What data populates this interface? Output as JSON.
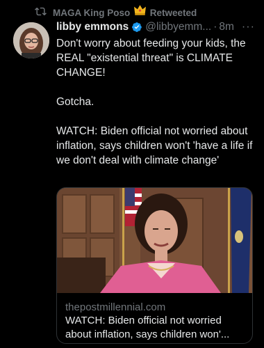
{
  "retweet": {
    "icon": "retweet-icon",
    "user": "MAGA King Poso",
    "badge_icon": "crown-emoji",
    "label": "Retweeted"
  },
  "tweet": {
    "author_name": "libby emmons",
    "verified_icon": "verified-badge-icon",
    "handle": "@libbyemm...",
    "separator": "·",
    "time": "8m",
    "more_icon": "more-icon",
    "more_text": "···",
    "paragraphs": [
      "Don't worry about feeding your kids, the REAL \"existential threat\" is CLIMATE CHANGE!",
      "Gotcha.",
      "WATCH: Biden official not worried about inflation, says children won't 'have a life if we don't deal with climate change'"
    ]
  },
  "card": {
    "domain": "thepostmillennial.com",
    "title": "WATCH: Biden official not worried about inflation, says children won'..."
  },
  "colors": {
    "background": "#000000",
    "text": "#e7e9ea",
    "muted": "#71767b",
    "verified": "#1d9bf0",
    "border": "#2f3336"
  }
}
